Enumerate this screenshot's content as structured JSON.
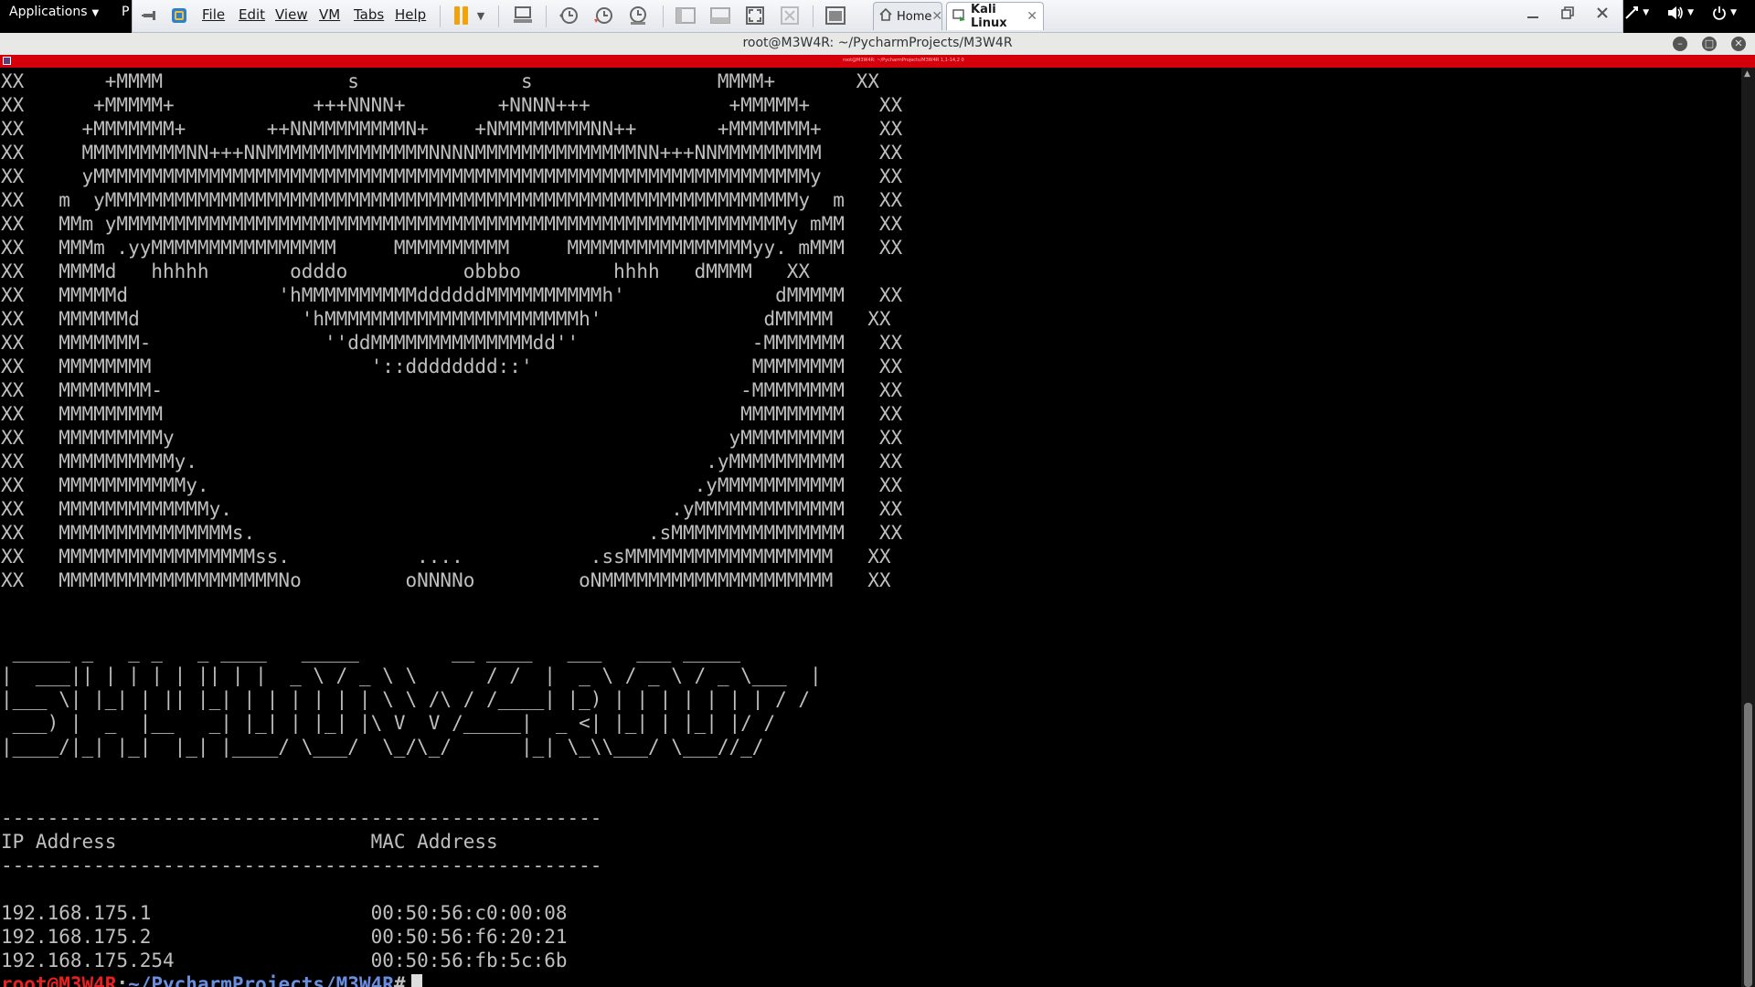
{
  "top_panel": {
    "applications_label": "Applications",
    "places_stub": "P",
    "tray_icons": [
      "network-icon",
      "volume-icon",
      "power-icon"
    ]
  },
  "vm_toolbar": {
    "menus": [
      "File",
      "Edit",
      "View",
      "VM",
      "Tabs",
      "Help"
    ],
    "tabs": [
      {
        "label": "Home",
        "active": false
      },
      {
        "label": "Kali Linux",
        "active": true
      }
    ]
  },
  "terminal": {
    "window_title": "root@M3W4R: ~/PycharmProjects/M3W4R",
    "inner_title": "root@M3W4R: ~/PycharmProjects/M3W4R 1,1-14,2 0",
    "lines": [
      "XX       +MMMM                s              s                MMMM+       XX",
      "XX      +MMMMM+            +++NNNN+        +NNNN+++            +MMMMM+      XX",
      "XX     +MMMMMMM+       ++NNMMMMMMMMN+    +NMMMMMMMMNN++       +MMMMMMM+     XX",
      "XX     MMMMMMMMMNN+++NNMMMMMMMMMMMMMMNNNNMMMMMMMMMMMMMMNN+++NNMMMMMMMMM     XX",
      "XX     yMMMMMMMMMMMMMMMMMMMMMMMMMMMMMMMMMMMMMMMMMMMMMMMMMMMMMMMMMMMMMMy     XX",
      "XX   m  yMMMMMMMMMMMMMMMMMMMMMMMMMMMMMMMMMMMMMMMMMMMMMMMMMMMMMMMMMMMMy  m   XX",
      "XX   MMm yMMMMMMMMMMMMMMMMMMMMMMMMMMMMMMMMMMMMMMMMMMMMMMMMMMMMMMMMMMy mMM   XX",
      "XX   MMMm .yyMMMMMMMMMMMMMMMM     MMMMMMMMMM     MMMMMMMMMMMMMMMMyy. mMMM   XX",
      "XX   MMMMd   hhhhh       odddo          obbbo        hhhh   dMMMM   XX",
      "XX   MMMMMd             'hMMMMMMMMMMddddddMMMMMMMMMMh'             dMMMMM   XX",
      "XX   MMMMMMd              'hMMMMMMMMMMMMMMMMMMMMMMh'              dMMMMM   XX",
      "XX   MMMMMMM-               ''ddMMMMMMMMMMMMMMdd''               -MMMMMMM   XX",
      "XX   MMMMMMMM                   '::dddddddd::'                   MMMMMMMM   XX",
      "XX   MMMMMMMM-                                                  -MMMMMMMM   XX",
      "XX   MMMMMMMMM                                                  MMMMMMMMM   XX",
      "XX   MMMMMMMMMy                                                yMMMMMMMMM   XX",
      "XX   MMMMMMMMMMy.                                            .yMMMMMMMMMM   XX",
      "XX   MMMMMMMMMMMy.                                          .yMMMMMMMMMMM   XX",
      "XX   MMMMMMMMMMMMMy.                                      .yMMMMMMMMMMMMM   XX",
      "XX   MMMMMMMMMMMMMMMs.                                  .sMMMMMMMMMMMMMMM   XX",
      "XX   MMMMMMMMMMMMMMMMMss.           ....           .ssMMMMMMMMMMMMMMMMMM   XX",
      "XX   MMMMMMMMMMMMMMMMMMMNo         oNNNNo         oNMMMMMMMMMMMMMMMMMMMM   XX",
      "",
      "",
      " _____ _   _ _   _ ____   _____        __ ____   ___   ___ _____",
      "|  ___|| | | | | || | |  _ \\ / _ \\ \\      / /  |  _ \\ / _ \\ / _ \\___  |",
      "|___ \\| |_| | || |_| | | | | | | \\ \\ /\\ / /____| |_) | | | | | | | / /",
      " ___) |  _  |__   _| |_| | |_| |\\ V  V /_____|  _ <| |_| | |_| |/ /",
      "|____/|_| |_|  |_| |____/ \\___/  \\_/\\_/      |_| \\_\\\\___/ \\___//_/",
      "",
      "",
      "----------------------------------------------------",
      "IP Address                      MAC Address",
      "----------------------------------------------------",
      "",
      "192.168.175.1                   00:50:56:c0:00:08",
      "192.168.175.2                   00:50:56:f6:20:21",
      "192.168.175.254                 00:50:56:fb:5c:6b"
    ],
    "prompt": {
      "user": "root@M3W4R",
      "colon": ":",
      "path": "~/PycharmProjects/M3W4R",
      "symbol": "#"
    }
  }
}
